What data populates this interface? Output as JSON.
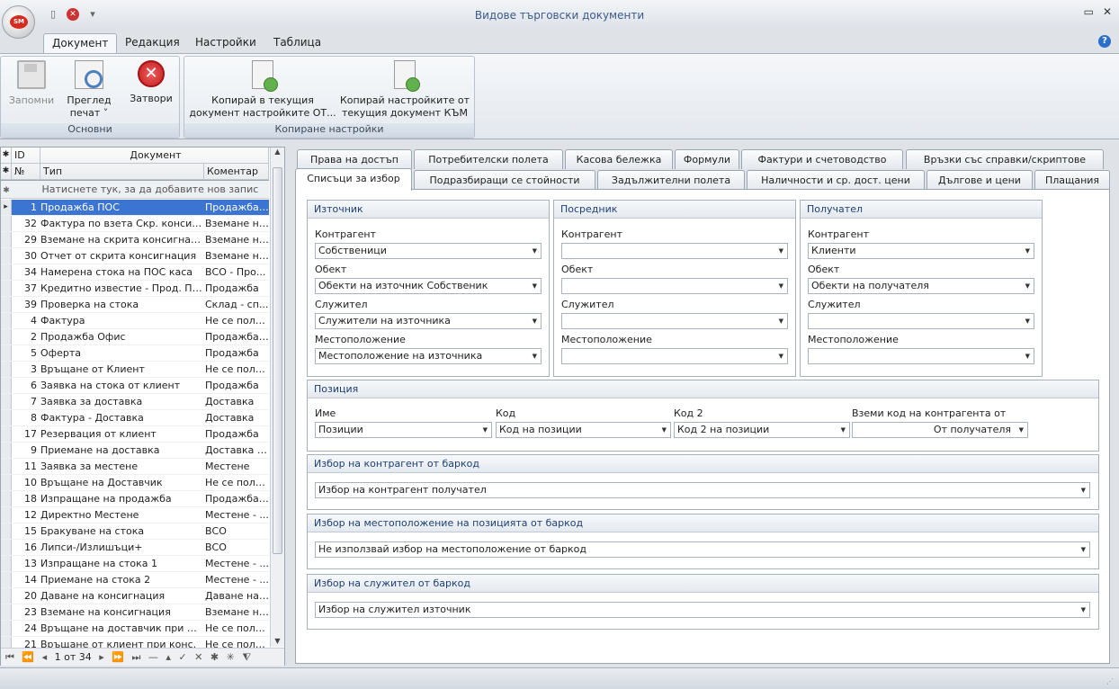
{
  "window": {
    "title": "Видове търговски документи",
    "orb": "SM"
  },
  "ribbon_tabs": [
    {
      "label": "Документ"
    },
    {
      "label": "Редакция"
    },
    {
      "label": "Настройки"
    },
    {
      "label": "Таблица"
    }
  ],
  "ribbon": {
    "save": "Запомни",
    "preview": "Преглед",
    "preview2": "печат ˅",
    "close": "Затвори",
    "group_basic": "Основни",
    "copy_to_line1": "Копирай в текущия",
    "copy_to_line2": "документ настройките ОТ...",
    "copy_from_line1": "Копирай настройките от",
    "copy_from_line2": "текущия документ КЪМ",
    "group_copy": "Копиране настройки"
  },
  "grid": {
    "col_id": "ID",
    "col_document": "Документ",
    "col_no": "№",
    "col_type": "Тип",
    "col_comment": "Коментар",
    "new_row_hint": "Натиснете тук, за да добавите нов запис",
    "selected_row": 0,
    "rows": [
      {
        "id": "1",
        "type": "Продажба ПОС",
        "comment": "Продажба ..."
      },
      {
        "id": "32",
        "type": "Фактура по взета Скр. консигн.",
        "comment": "Вземане на..."
      },
      {
        "id": "29",
        "type": "Вземане на скрита консигнация",
        "comment": "Вземане на..."
      },
      {
        "id": "30",
        "type": "Отчет от скрита консигнация",
        "comment": "Вземане на..."
      },
      {
        "id": "34",
        "type": "Намерена стока на ПОС каса",
        "comment": "ВСО - Про..."
      },
      {
        "id": "37",
        "type": "Кредитно известие - Прод.  ПОС",
        "comment": "Продажба"
      },
      {
        "id": "39",
        "type": "Проверка на стока",
        "comment": "Склад - сп..."
      },
      {
        "id": "4",
        "type": "Фактура",
        "comment": "Не се полз..."
      },
      {
        "id": "2",
        "type": "Продажба Офис",
        "comment": "Продажба ..."
      },
      {
        "id": "5",
        "type": "Оферта",
        "comment": "Продажба"
      },
      {
        "id": "3",
        "type": "Връщане от Клиент",
        "comment": "Не се полз..."
      },
      {
        "id": "6",
        "type": "Заявка на стока от клиент",
        "comment": "Продажба"
      },
      {
        "id": "7",
        "type": "Заявка за доставка",
        "comment": "Доставка"
      },
      {
        "id": "8",
        "type": "Фактура - Доставка",
        "comment": "Доставка"
      },
      {
        "id": "17",
        "type": "Резервация от клиент",
        "comment": "Продажба"
      },
      {
        "id": "9",
        "type": "Приемане на доставка",
        "comment": "Доставка -..."
      },
      {
        "id": "11",
        "type": "Заявка за местене",
        "comment": "Местене"
      },
      {
        "id": "10",
        "type": "Връщане на Доставчик",
        "comment": "Не се полз..."
      },
      {
        "id": "18",
        "type": "Изпращане на продажба",
        "comment": "Продажба ..."
      },
      {
        "id": "12",
        "type": "Директно Местене",
        "comment": "Местене - ..."
      },
      {
        "id": "15",
        "type": "Бракуване на стока",
        "comment": "ВСО"
      },
      {
        "id": "16",
        "type": "Липси-/Излишъци+",
        "comment": "ВСО"
      },
      {
        "id": "13",
        "type": "Изпращане на стока 1",
        "comment": "Местене - ..."
      },
      {
        "id": "14",
        "type": "Приемане на стока 2",
        "comment": "Местене - ..."
      },
      {
        "id": "20",
        "type": "Даване на консигнация",
        "comment": "Даване на ..."
      },
      {
        "id": "23",
        "type": "Вземане на консигнация",
        "comment": "Вземане на..."
      },
      {
        "id": "24",
        "type": "Връщане на доставчик при конс.",
        "comment": "Не се полз..."
      },
      {
        "id": "21",
        "type": "Връщане от клиент при конс.",
        "comment": "Не се полз..."
      }
    ],
    "pager": "1 от 34"
  },
  "tabs_row1": [
    "Права на достъп",
    "Потребителски полета",
    "Касова бележка",
    "Формули",
    "Фактури и счетоводство",
    "Връзки със справки/скриптове"
  ],
  "tabs_row2": [
    "Списъци за избор",
    "Подразбиращи се стойности",
    "Задължителни полета",
    "Наличности и ср. дост. цени",
    "Дългове и цени",
    "Плащания"
  ],
  "active_tab": "Списъци за избор",
  "source": {
    "title": "Източник",
    "partner_label": "Контрагент",
    "partner": "Собственици",
    "object_label": "Обект",
    "object": "Обекти на източник Собственик",
    "employee_label": "Служител",
    "employee": "Служители на източника",
    "location_label": "Местоположение",
    "location": "Местоположение на източника"
  },
  "intermediary": {
    "title": "Посредник",
    "partner_label": "Контрагент",
    "partner": "",
    "object_label": "Обект",
    "object": "",
    "employee_label": "Служител",
    "employee": "",
    "location_label": "Местоположение",
    "location": ""
  },
  "recipient": {
    "title": "Получател",
    "partner_label": "Контрагент",
    "partner": "Клиенти",
    "object_label": "Обект",
    "object": "Обекти на получателя",
    "employee_label": "Служител",
    "employee": "",
    "location_label": "Местоположение",
    "location": ""
  },
  "position": {
    "title": "Позиция",
    "name_label": "Име",
    "name": "Позиции",
    "code_label": "Код",
    "code": "Код на позиции",
    "code2_label": "Код 2",
    "code2": "Код 2 на позиции",
    "partner_code_label": "Вземи код на контрагента от",
    "partner_code": "От получателя"
  },
  "barcode_partner": {
    "title": "Избор на контрагент от баркод",
    "value": "Избор на контрагент получател"
  },
  "barcode_location": {
    "title": "Избор на местоположение на позицията от баркод",
    "value": "Не използвай избор на местоположение от баркод"
  },
  "barcode_employee": {
    "title": "Избор на служител от баркод",
    "value": "Избор на служител източник"
  }
}
